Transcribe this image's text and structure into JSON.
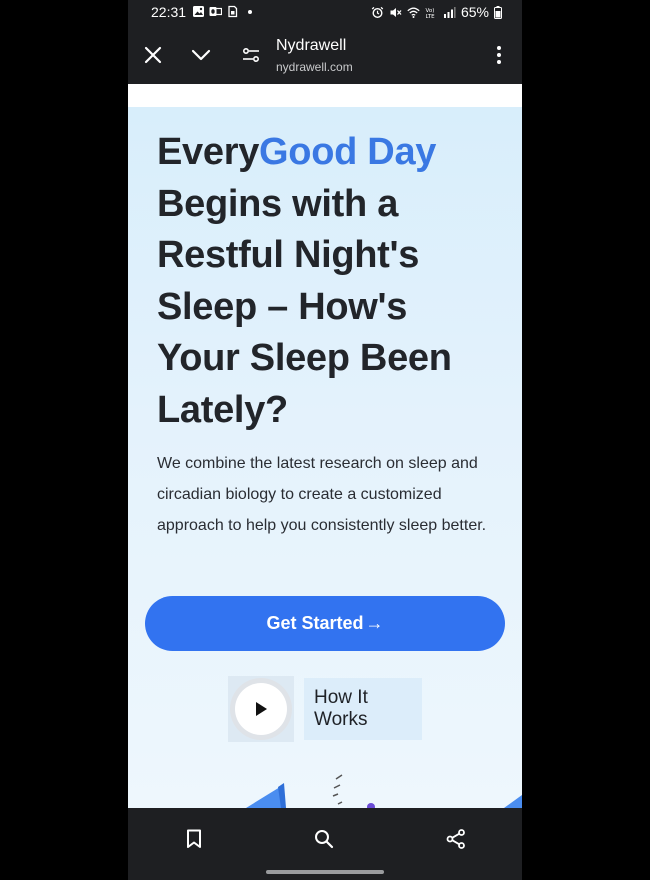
{
  "status_bar": {
    "time": "22:31",
    "battery": "65%",
    "icons": [
      "gallery-icon",
      "outlook-icon",
      "sim-icon",
      "dot-icon",
      "alarm-icon",
      "mute-icon",
      "wifi-icon",
      "volte-icon",
      "signal-icon",
      "battery-icon"
    ]
  },
  "toolbar": {
    "title": "Nydrawell",
    "url": "nydrawell.com",
    "icons": [
      "close-icon",
      "chevron-down-icon",
      "page-info-icon",
      "more-vert-icon"
    ]
  },
  "hero": {
    "headline_plain_1": "Every",
    "headline_accent": "Good Day",
    "headline_rest": "Begins with a Restful Night's Sleep – How's Your Sleep Been Lately?",
    "body": "We combine the latest research on sleep and circadian biology to create a customized approach to help you consistently sleep better.",
    "cta_label": "Get Started",
    "cta_arrow": "→",
    "how_it_works_label": "How It Works"
  },
  "bottom_bar": {
    "icons": [
      "bookmark-icon",
      "search-icon",
      "share-icon"
    ]
  },
  "colors": {
    "accent": "#3a78e3",
    "cta": "#3273f0",
    "hero_bg": "#d8eefb",
    "text": "#22252a"
  }
}
